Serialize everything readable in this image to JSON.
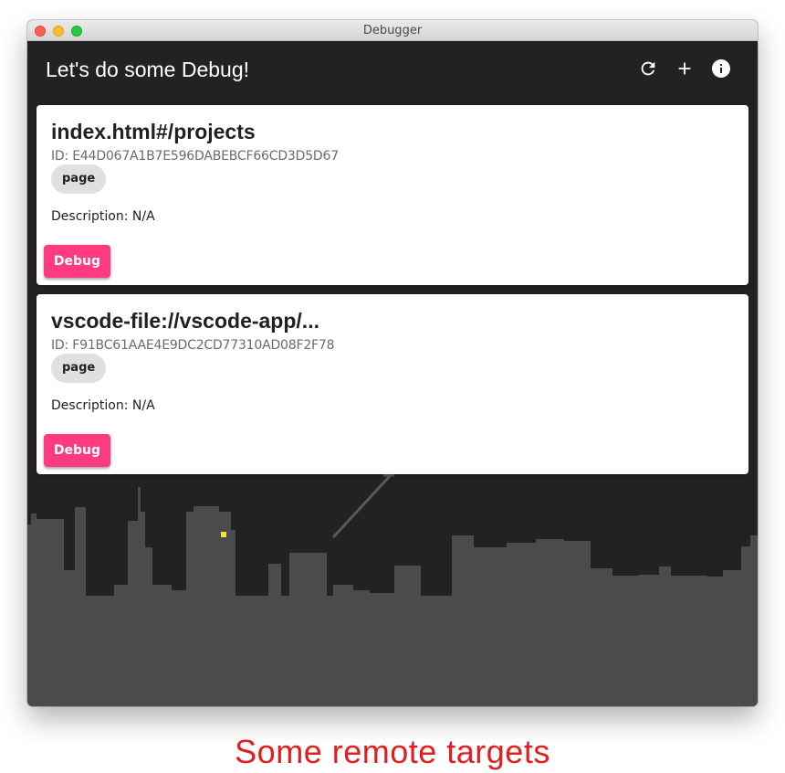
{
  "window": {
    "title": "Debugger"
  },
  "header": {
    "title": "Let's do some Debug!",
    "actions": [
      {
        "icon": "refresh-icon"
      },
      {
        "icon": "plus-icon"
      },
      {
        "icon": "info-icon"
      }
    ]
  },
  "targets": [
    {
      "title": "index.html#/projects",
      "id": "ID: E44D067A1B7E596DABEBCF66CD3D5D67",
      "type": "page",
      "description": "Description: N/A",
      "button": "Debug"
    },
    {
      "title": "vscode-file://vscode-app/...",
      "id": "ID: F91BC61AAE4E9DC2CD77310AD08F2F78",
      "type": "page",
      "description": "Description: N/A",
      "button": "Debug"
    }
  ],
  "caption": "Some remote targets",
  "colors": {
    "appbar": "#232122",
    "accent": "#ff3b7f",
    "skyline": "#4b4a4c",
    "caption": "#e02020",
    "window_light": "#f5e13c"
  }
}
